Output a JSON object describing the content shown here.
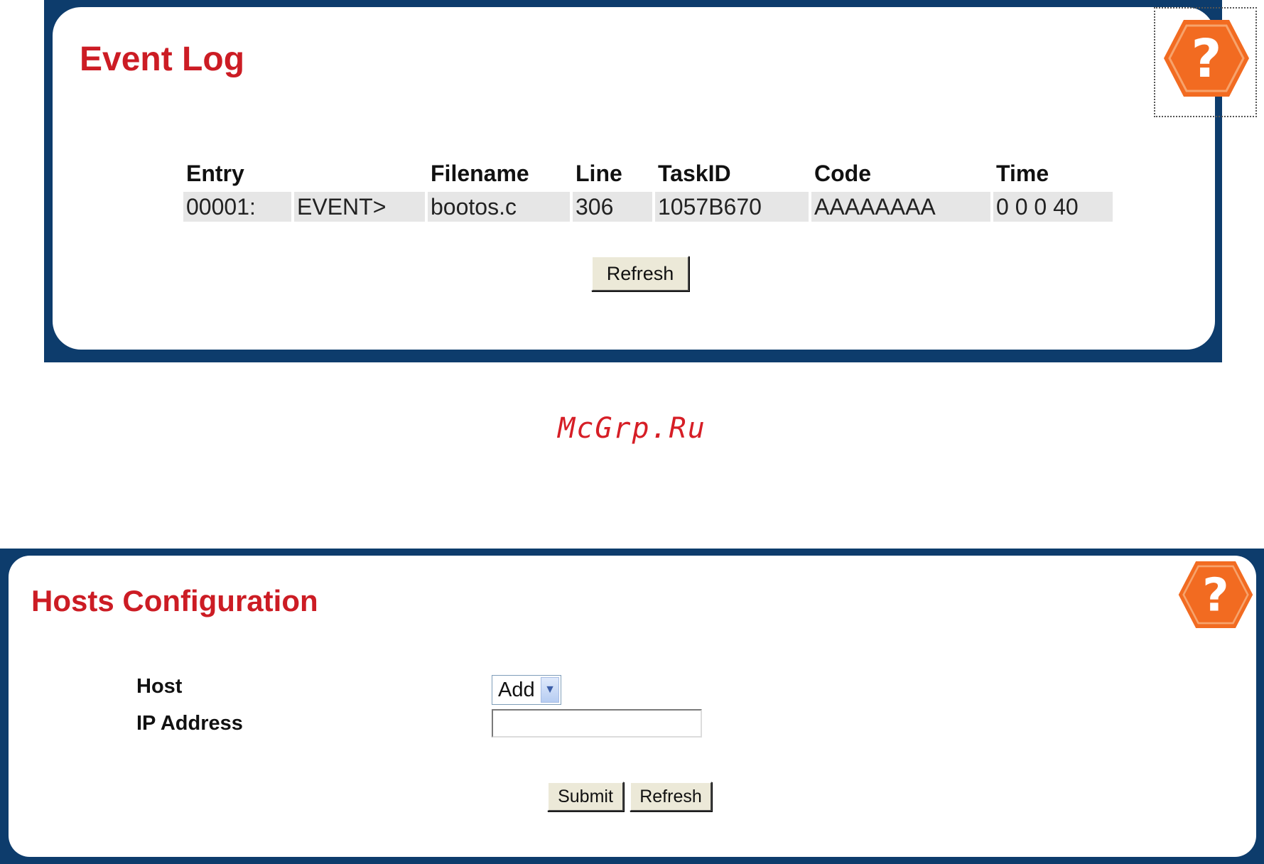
{
  "event_log": {
    "title": "Event Log",
    "help_icon": "help-question-icon",
    "columns": [
      "Entry",
      "Filename",
      "Line",
      "TaskID",
      "Code",
      "Time"
    ],
    "rows": [
      {
        "entry": "00001:",
        "type": "EVENT>",
        "filename": "bootos.c",
        "line": "306",
        "task_id": "1057B670",
        "code": "AAAAAAAA",
        "time": "0 0 0 40"
      }
    ],
    "refresh_label": "Refresh"
  },
  "watermark": "McGrp.Ru",
  "hosts_config": {
    "title": "Hosts Configuration",
    "help_icon": "help-question-icon",
    "host_label": "Host",
    "host_value": "Add",
    "ip_label": "IP Address",
    "ip_value": "",
    "submit_label": "Submit",
    "refresh_label": "Refresh"
  },
  "colors": {
    "frame": "#0d3c6c",
    "title": "#cc1c24",
    "help_orange": "#f26b21",
    "row_bg": "#e6e6e6",
    "button_bg": "#ece9d8"
  }
}
